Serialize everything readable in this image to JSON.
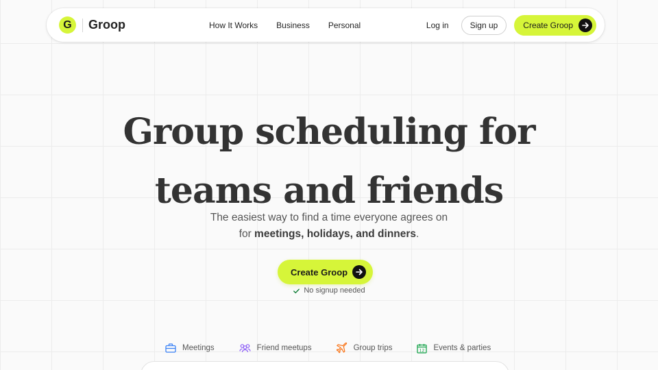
{
  "brand": {
    "logo_letter": "G",
    "name": "Groop",
    "accent_color": "#d6f539"
  },
  "nav": {
    "links": [
      "How It Works",
      "Business",
      "Personal"
    ],
    "login_label": "Log in",
    "signup_label": "Sign up",
    "create_label": "Create Groop"
  },
  "hero": {
    "title_line1": "Group scheduling for",
    "title_line2": "teams and friends",
    "subtitle_line1": "The easiest way to find a time everyone agrees on",
    "subtitle_line2_prefix": "for ",
    "subtitle_line2_bold": "meetings, holidays, and dinners",
    "subtitle_line2_suffix": ".",
    "cta_label": "Create Groop",
    "no_signup": "No signup needed"
  },
  "categories": [
    {
      "label": "Meetings",
      "icon": "briefcase-icon",
      "color": "#3b82f6"
    },
    {
      "label": "Friend meetups",
      "icon": "people-icon",
      "color": "#8b5cf6"
    },
    {
      "label": "Group trips",
      "icon": "airplane-icon",
      "color": "#f97316"
    },
    {
      "label": "Events & parties",
      "icon": "calendar-icon",
      "color": "#16a34a",
      "calendar_day": "12"
    }
  ]
}
